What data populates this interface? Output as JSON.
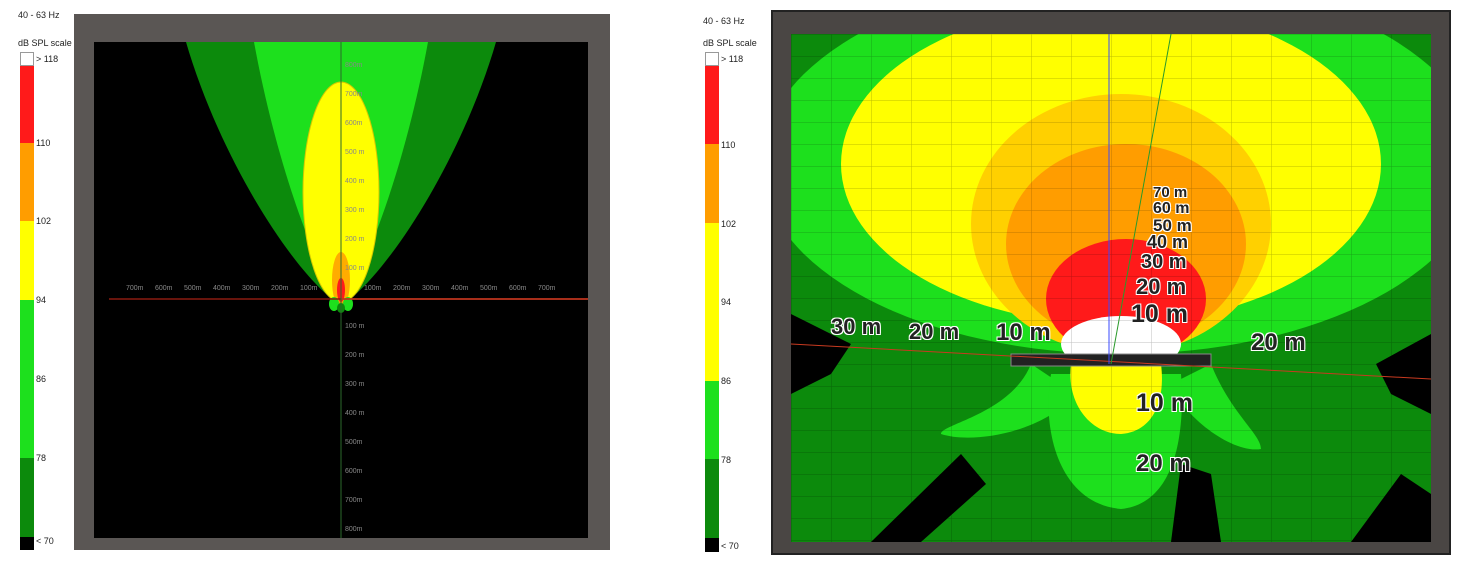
{
  "left_panel": {
    "legend": {
      "freq": "40 - 63 Hz",
      "scale_title": "dB SPL scale",
      "labels": [
        "> 118",
        "110",
        "102",
        "94",
        "86",
        "78",
        "< 70"
      ]
    },
    "axis": {
      "y_up": [
        "100 m",
        "200 m",
        "300 m",
        "400 m",
        "500 m",
        "600m",
        "700m",
        "800m"
      ],
      "y_down": [
        "100 m",
        "200 m",
        "300 m",
        "400 m",
        "500m",
        "600m",
        "700m",
        "800m"
      ],
      "x_left": [
        "100m",
        "200m",
        "300m",
        "400m",
        "500m",
        "600m",
        "700m"
      ],
      "x_right": [
        "100m",
        "200m",
        "300m",
        "400m",
        "500m",
        "600m",
        "700m"
      ]
    }
  },
  "right_panel": {
    "legend": {
      "freq": "40 - 63 Hz",
      "scale_title": "dB SPL scale",
      "labels": [
        "> 118",
        "110",
        "102",
        "94",
        "86",
        "78",
        "< 70"
      ]
    },
    "dist_labels": [
      "70 m",
      "60 m",
      "50 m",
      "40 m",
      "30 m",
      "20 m",
      "10 m",
      "30 m",
      "20 m",
      "10 m",
      "20 m",
      "10 m",
      "20 m"
    ]
  },
  "colors": {
    "white": "#ffffff",
    "red": "#ff1a1a",
    "orange": "#ff9d00",
    "yellow": "#ffff00",
    "bright_green": "#1de01d",
    "dark_green": "#0c8a0c",
    "black": "#000000",
    "frame": "#5a5654"
  }
}
